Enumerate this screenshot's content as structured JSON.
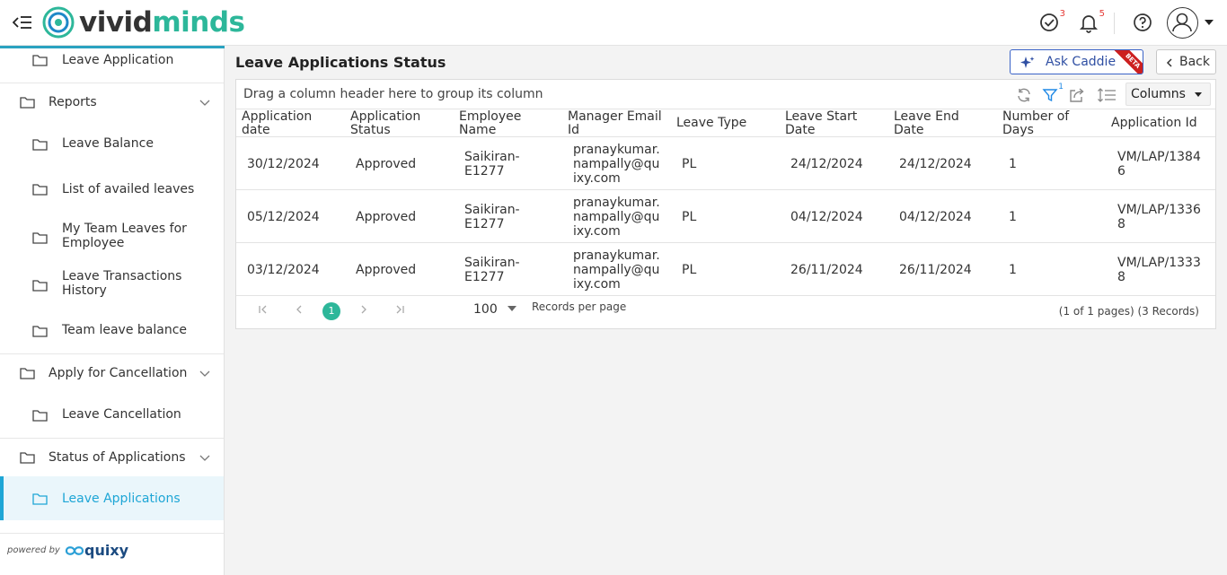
{
  "brand": {
    "logo_part1": "vivid",
    "logo_part2": "minds",
    "powered_by": "powered by",
    "powered_logo": "quixy"
  },
  "header": {
    "tasks_badge": "3",
    "notifications_badge": "5"
  },
  "sidebar": {
    "items": [
      {
        "label": "Leave Application"
      },
      {
        "label": "Reports"
      },
      {
        "label": "Leave Balance"
      },
      {
        "label": "List of availed leaves"
      },
      {
        "label": "My Team Leaves for Employee"
      },
      {
        "label": "Leave Transactions History"
      },
      {
        "label": "Team leave balance"
      },
      {
        "label": "Apply for Cancellation"
      },
      {
        "label": "Leave Cancellation"
      },
      {
        "label": "Status of Applications"
      },
      {
        "label": "Leave Applications"
      }
    ]
  },
  "main": {
    "title": "Leave Applications Status",
    "ask_caddie": "Ask Caddie",
    "beta": "BETA",
    "back": "Back",
    "group_hint": "Drag a column header here to group its column",
    "filter_badge": "1",
    "columns_label": "Columns"
  },
  "table": {
    "headers": [
      "Application date",
      "Application Status",
      "Employee Name",
      "Manager Email Id",
      "Leave Type",
      "Leave Start Date",
      "Leave End Date",
      "Number of Days",
      "Application Id"
    ],
    "rows": [
      [
        "30/12/2024",
        "Approved",
        "Saikiran-E1277",
        "pranaykumar.nampally@quixy.com",
        "PL",
        "24/12/2024",
        "24/12/2024",
        "1",
        "VM/LAP/13846"
      ],
      [
        "05/12/2024",
        "Approved",
        "Saikiran-E1277",
        "pranaykumar.nampally@quixy.com",
        "PL",
        "04/12/2024",
        "04/12/2024",
        "1",
        "VM/LAP/13368"
      ],
      [
        "03/12/2024",
        "Approved",
        "Saikiran-E1277",
        "pranaykumar.nampally@quixy.com",
        "PL",
        "26/11/2024",
        "26/11/2024",
        "1",
        "VM/LAP/13338"
      ]
    ]
  },
  "pager": {
    "current_page": "1",
    "page_size": "100",
    "records_per_page": "Records per page",
    "info": "(1 of 1 pages) (3 Records)"
  },
  "colors": {
    "accent": "#2db79a",
    "active_bar": "#1ea6d6",
    "beta": "#cc1f1f"
  }
}
